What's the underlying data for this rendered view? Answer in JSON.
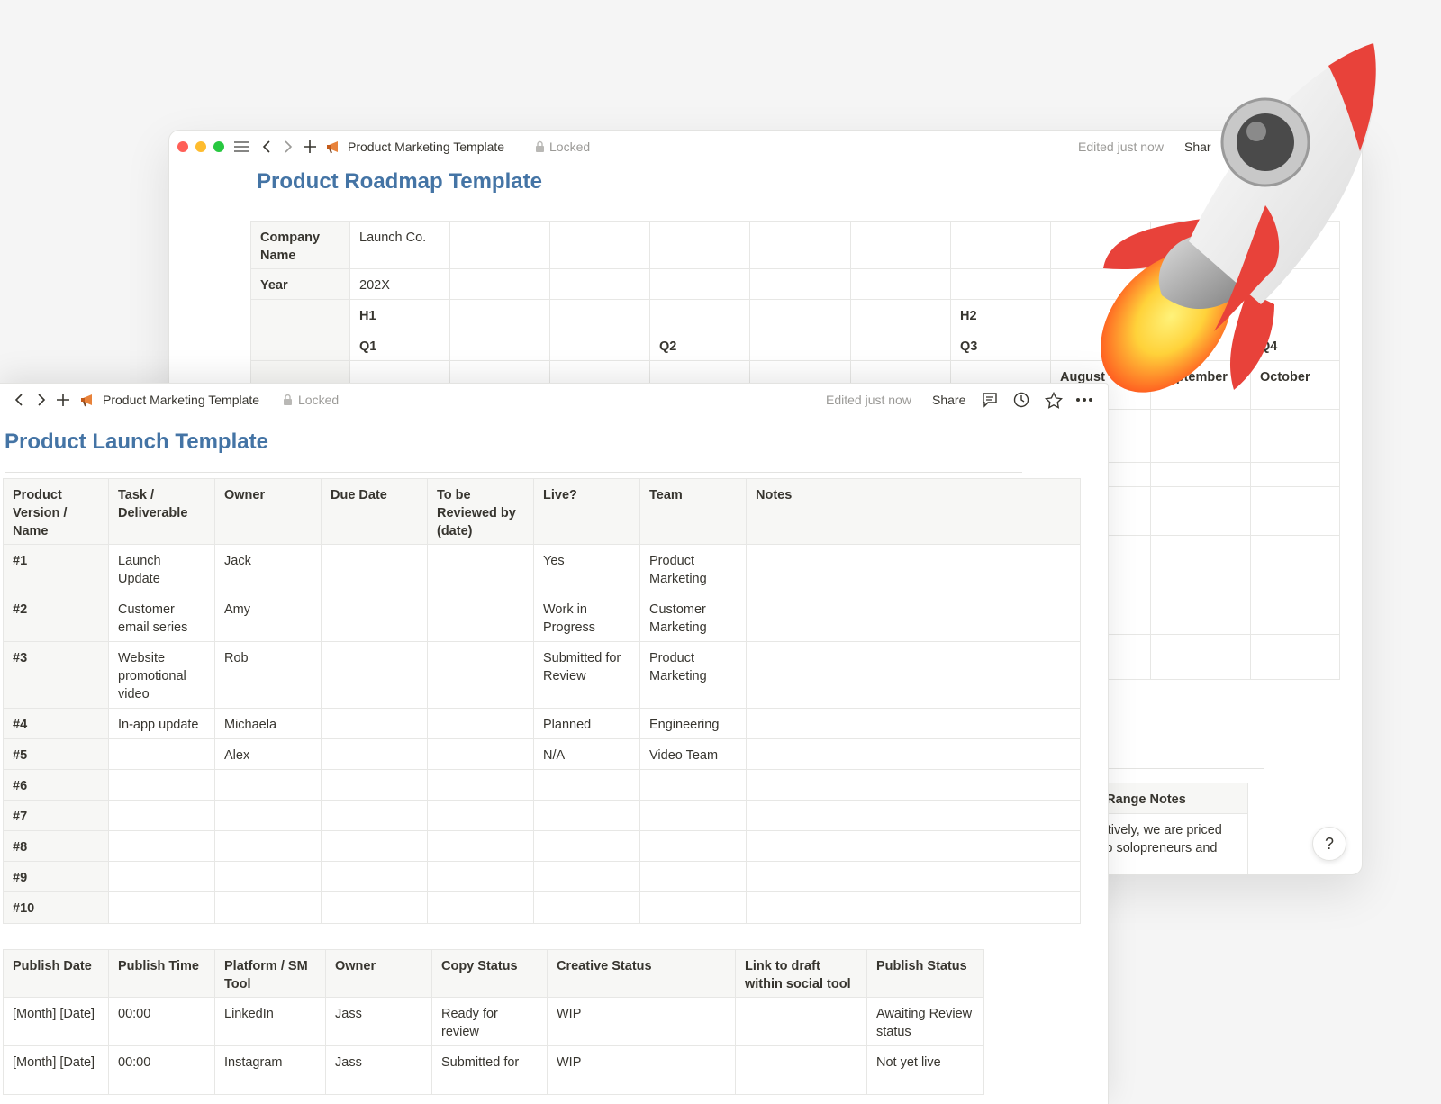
{
  "back_window": {
    "breadcrumb_title": "Product Marketing Template",
    "locked_label": "Locked",
    "edited_label": "Edited just now",
    "share_label": "Shar",
    "page_title": "Product Roadmap Template",
    "roadmap": [
      [
        "Company Name",
        "Launch Co.",
        "",
        "",
        "",
        "",
        "",
        "",
        "",
        "",
        ""
      ],
      [
        "Year",
        "202X",
        "",
        "",
        "",
        "",
        "",
        "",
        "",
        "",
        ""
      ],
      [
        "",
        "H1",
        "",
        "",
        "",
        "",
        "",
        "H2",
        "",
        "",
        ""
      ],
      [
        "",
        "Q1",
        "",
        "",
        "Q2",
        "",
        "",
        "Q3",
        "",
        "",
        "Q4"
      ],
      [
        "",
        "",
        "",
        "",
        "",
        "",
        "",
        "",
        "August",
        "September",
        "October"
      ]
    ],
    "notes_header": "ce Range Notes",
    "notes_text": "llectively, we are priced\nhelp solopreneurs and"
  },
  "front_window": {
    "breadcrumb_title": "Product Marketing Template",
    "locked_label": "Locked",
    "edited_label": "Edited just now",
    "share_label": "Share",
    "page_title": "Product Launch Template",
    "launch_table": {
      "headers": [
        "Product Version / Name",
        "Task / Deliverable",
        "Owner",
        "Due Date",
        "To be Reviewed by (date)",
        "Live?",
        "Team",
        "Notes"
      ],
      "rows": [
        [
          "#1",
          "Launch Update",
          "Jack",
          "",
          "",
          "Yes",
          "Product Marketing",
          ""
        ],
        [
          "#2",
          "Customer email series",
          "Amy",
          "",
          "",
          "Work in Progress",
          "Customer Marketing",
          ""
        ],
        [
          "#3",
          "Website promotional video",
          "Rob",
          "",
          "",
          "Submitted for Review",
          "Product Marketing",
          ""
        ],
        [
          "#4",
          "In-app update",
          "Michaela",
          "",
          "",
          "Planned",
          "Engineering",
          ""
        ],
        [
          "#5",
          "",
          "Alex",
          "",
          "",
          "N/A",
          "Video Team",
          ""
        ],
        [
          "#6",
          "",
          "",
          "",
          "",
          "",
          "",
          ""
        ],
        [
          "#7",
          "",
          "",
          "",
          "",
          "",
          "",
          ""
        ],
        [
          "#8",
          "",
          "",
          "",
          "",
          "",
          "",
          ""
        ],
        [
          "#9",
          "",
          "",
          "",
          "",
          "",
          "",
          ""
        ],
        [
          "#10",
          "",
          "",
          "",
          "",
          "",
          "",
          ""
        ]
      ]
    },
    "publish_table": {
      "headers": [
        "Publish Date",
        "Publish Time",
        "Platform / SM Tool",
        "Owner",
        "Copy Status",
        "Creative Status",
        "Link to draft within social tool",
        "Publish Status"
      ],
      "rows": [
        [
          "[Month] [Date]",
          "00:00",
          "LinkedIn",
          "Jass",
          "Ready for review",
          "WIP",
          "",
          "Awaiting Review status"
        ],
        [
          "[Month] [Date]",
          "00:00",
          "Instagram",
          "Jass",
          "Submitted for",
          "WIP",
          "",
          "Not yet live"
        ]
      ]
    }
  },
  "help_label": "?",
  "icons": [
    "menu-icon",
    "back-arrow-icon",
    "forward-arrow-icon",
    "plus-icon",
    "megaphone-icon",
    "lock-icon",
    "comment-icon",
    "clock-icon",
    "star-icon",
    "more-icon",
    "rocket-icon"
  ],
  "colors": {
    "title_blue": "#4474a5",
    "header_bg": "#f7f7f5",
    "rocket_red": "#e8423a"
  }
}
